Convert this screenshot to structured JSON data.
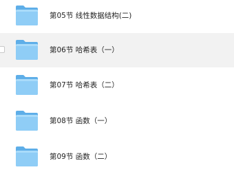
{
  "files": [
    {
      "name": "第05节 线性数据结构(二)",
      "icon": "folder-icon",
      "hovered": false
    },
    {
      "name": "第06节 哈希表（一）",
      "icon": "folder-icon",
      "hovered": true
    },
    {
      "name": "第07节 哈希表（二）",
      "icon": "folder-icon",
      "hovered": false
    },
    {
      "name": "第08节 函数（一）",
      "icon": "folder-icon",
      "hovered": false
    },
    {
      "name": "第09节 函数（二）",
      "icon": "folder-icon",
      "hovered": false
    }
  ],
  "colors": {
    "folder_back": "#5eaee8",
    "folder_front": "#8fcdf6",
    "hover_background": "#f2f2f2",
    "text": "#1f1f1f"
  }
}
